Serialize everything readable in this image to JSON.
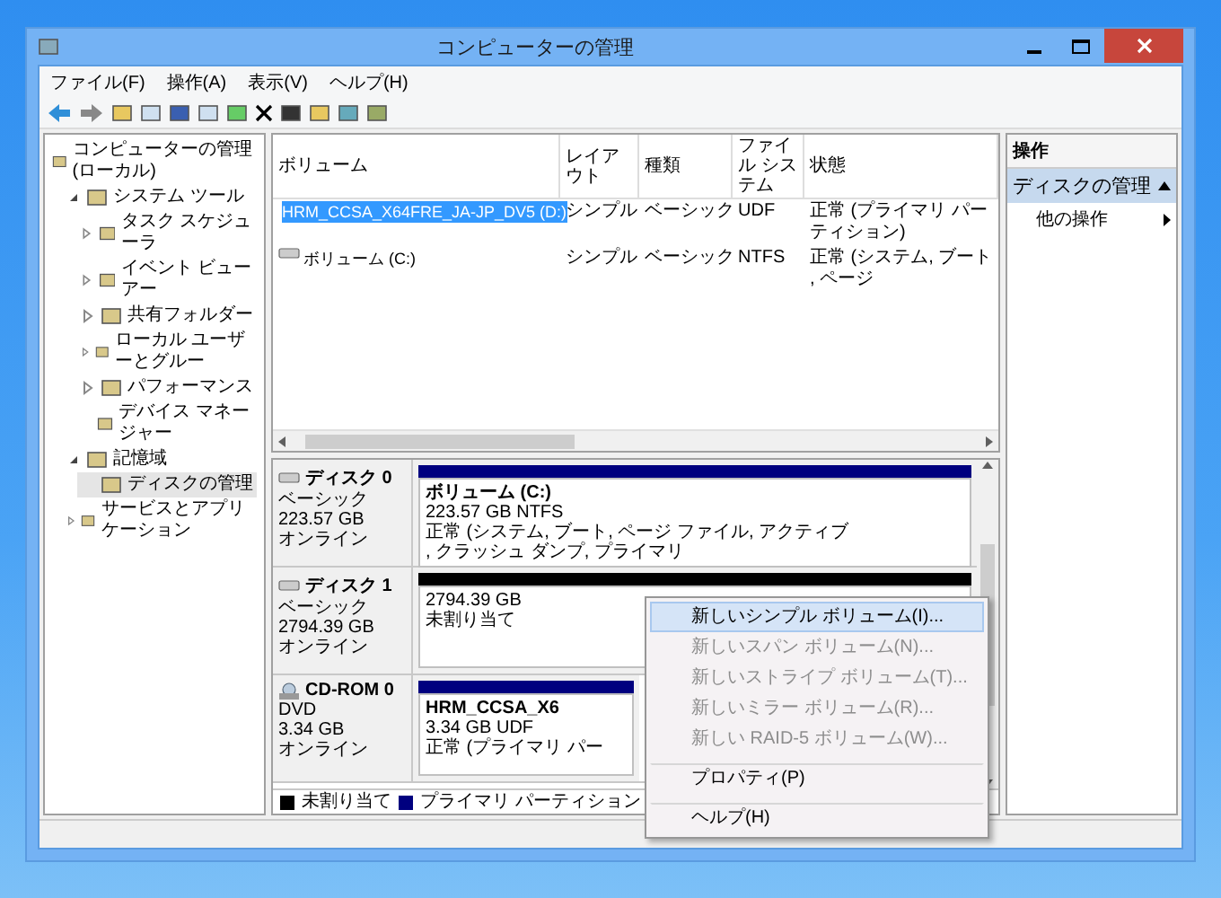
{
  "window": {
    "title": "コンピューターの管理"
  },
  "menu_bar": [
    "ファイル(F)",
    "操作(A)",
    "表示(V)",
    "ヘルプ(H)"
  ],
  "tree": [
    {
      "label": "コンピューターの管理 (ローカル)",
      "selected": false,
      "children": [
        {
          "label": "システム ツール",
          "expanded": true,
          "selected": false,
          "children": [
            {
              "label": "タスク スケジューラ",
              "expanded": false,
              "selected": false
            },
            {
              "label": "イベント ビューアー",
              "expanded": false,
              "selected": false
            },
            {
              "label": "共有フォルダー",
              "expanded": false,
              "selected": false
            },
            {
              "label": "ローカル ユーザーとグルー",
              "expanded": false,
              "selected": false
            },
            {
              "label": "パフォーマンス",
              "expanded": false,
              "selected": false
            },
            {
              "label": "デバイス マネージャー",
              "selected": false
            }
          ]
        },
        {
          "label": "記憶域",
          "expanded": true,
          "selected": false,
          "children": [
            {
              "label": "ディスクの管理",
              "selected": true
            }
          ]
        },
        {
          "label": "サービスとアプリケーション",
          "expanded": false,
          "selected": false
        }
      ]
    }
  ],
  "volume_table": {
    "columns": [
      "ボリューム",
      "レイアウト",
      "種類",
      "ファイル システム",
      "状態"
    ],
    "rows": [
      {
        "kind": "cdrom",
        "selected": true,
        "cells": [
          "HRM_CCSA_X64FRE_JA-JP_DV5 (D:)",
          "シンプル",
          "ベーシック",
          "UDF",
          "正常 (プライマリ パーティション)"
        ]
      },
      {
        "kind": "disk",
        "selected": false,
        "cells": [
          "ボリューム (C:)",
          "シンプル",
          "ベーシック",
          "NTFS",
          "正常 (システム, ブート, ページ"
        ]
      }
    ]
  },
  "disks": [
    {
      "kind": "disk",
      "name": "ディスク 0",
      "details": [
        "ベーシック",
        "223.57 GB",
        "オンライン"
      ],
      "color": "#00007f",
      "partition": {
        "title": "ボリューム (C:)",
        "lines": [
          "223.57 GB NTFS",
          "正常 (システム, ブート, ページ ファイル, アクティブ, クラッシュ ダンプ, プライマリ"
        ]
      }
    },
    {
      "kind": "disk",
      "name": "ディスク 1",
      "details": [
        "ベーシック",
        "2794.39 GB",
        "オンライン"
      ],
      "color": "#000000",
      "partition": {
        "lines": [
          "2794.39 GB",
          "未割り当て"
        ]
      }
    },
    {
      "kind": "cdrom",
      "name": "CD-ROM 0",
      "details": [
        "DVD",
        "3.34 GB",
        "オンライン"
      ],
      "color": "#00007f",
      "partition": {
        "title": "HRM_CCSA_X6",
        "lines": [
          "3.34 GB UDF",
          "正常 (プライマリ パー"
        ]
      }
    }
  ],
  "legend": [
    {
      "label": "未割り当て",
      "color": "#000000"
    },
    {
      "label": "プライマリ パーティション",
      "color": "#00007f"
    }
  ],
  "actions": {
    "title": "操作",
    "section": {
      "label": "ディスクの管理",
      "expanded": true
    },
    "items": [
      {
        "label": "他の操作"
      }
    ]
  },
  "context_menu": [
    {
      "label": "新しいシンプル ボリューム(I)...",
      "disabled": false,
      "selected": true,
      "separator_before": false
    },
    {
      "label": "新しいスパン ボリューム(N)...",
      "disabled": true,
      "selected": false,
      "separator_before": false
    },
    {
      "label": "新しいストライプ ボリューム(T)...",
      "disabled": true,
      "selected": false,
      "separator_before": false
    },
    {
      "label": "新しいミラー ボリューム(R)...",
      "disabled": true,
      "selected": false,
      "separator_before": false
    },
    {
      "label": "新しい RAID-5 ボリューム(W)...",
      "disabled": true,
      "selected": false,
      "separator_before": false
    },
    {
      "label": "プロパティ(P)",
      "disabled": false,
      "selected": false,
      "separator_before": true
    },
    {
      "label": "ヘルプ(H)",
      "disabled": false,
      "selected": false,
      "separator_before": true
    }
  ]
}
